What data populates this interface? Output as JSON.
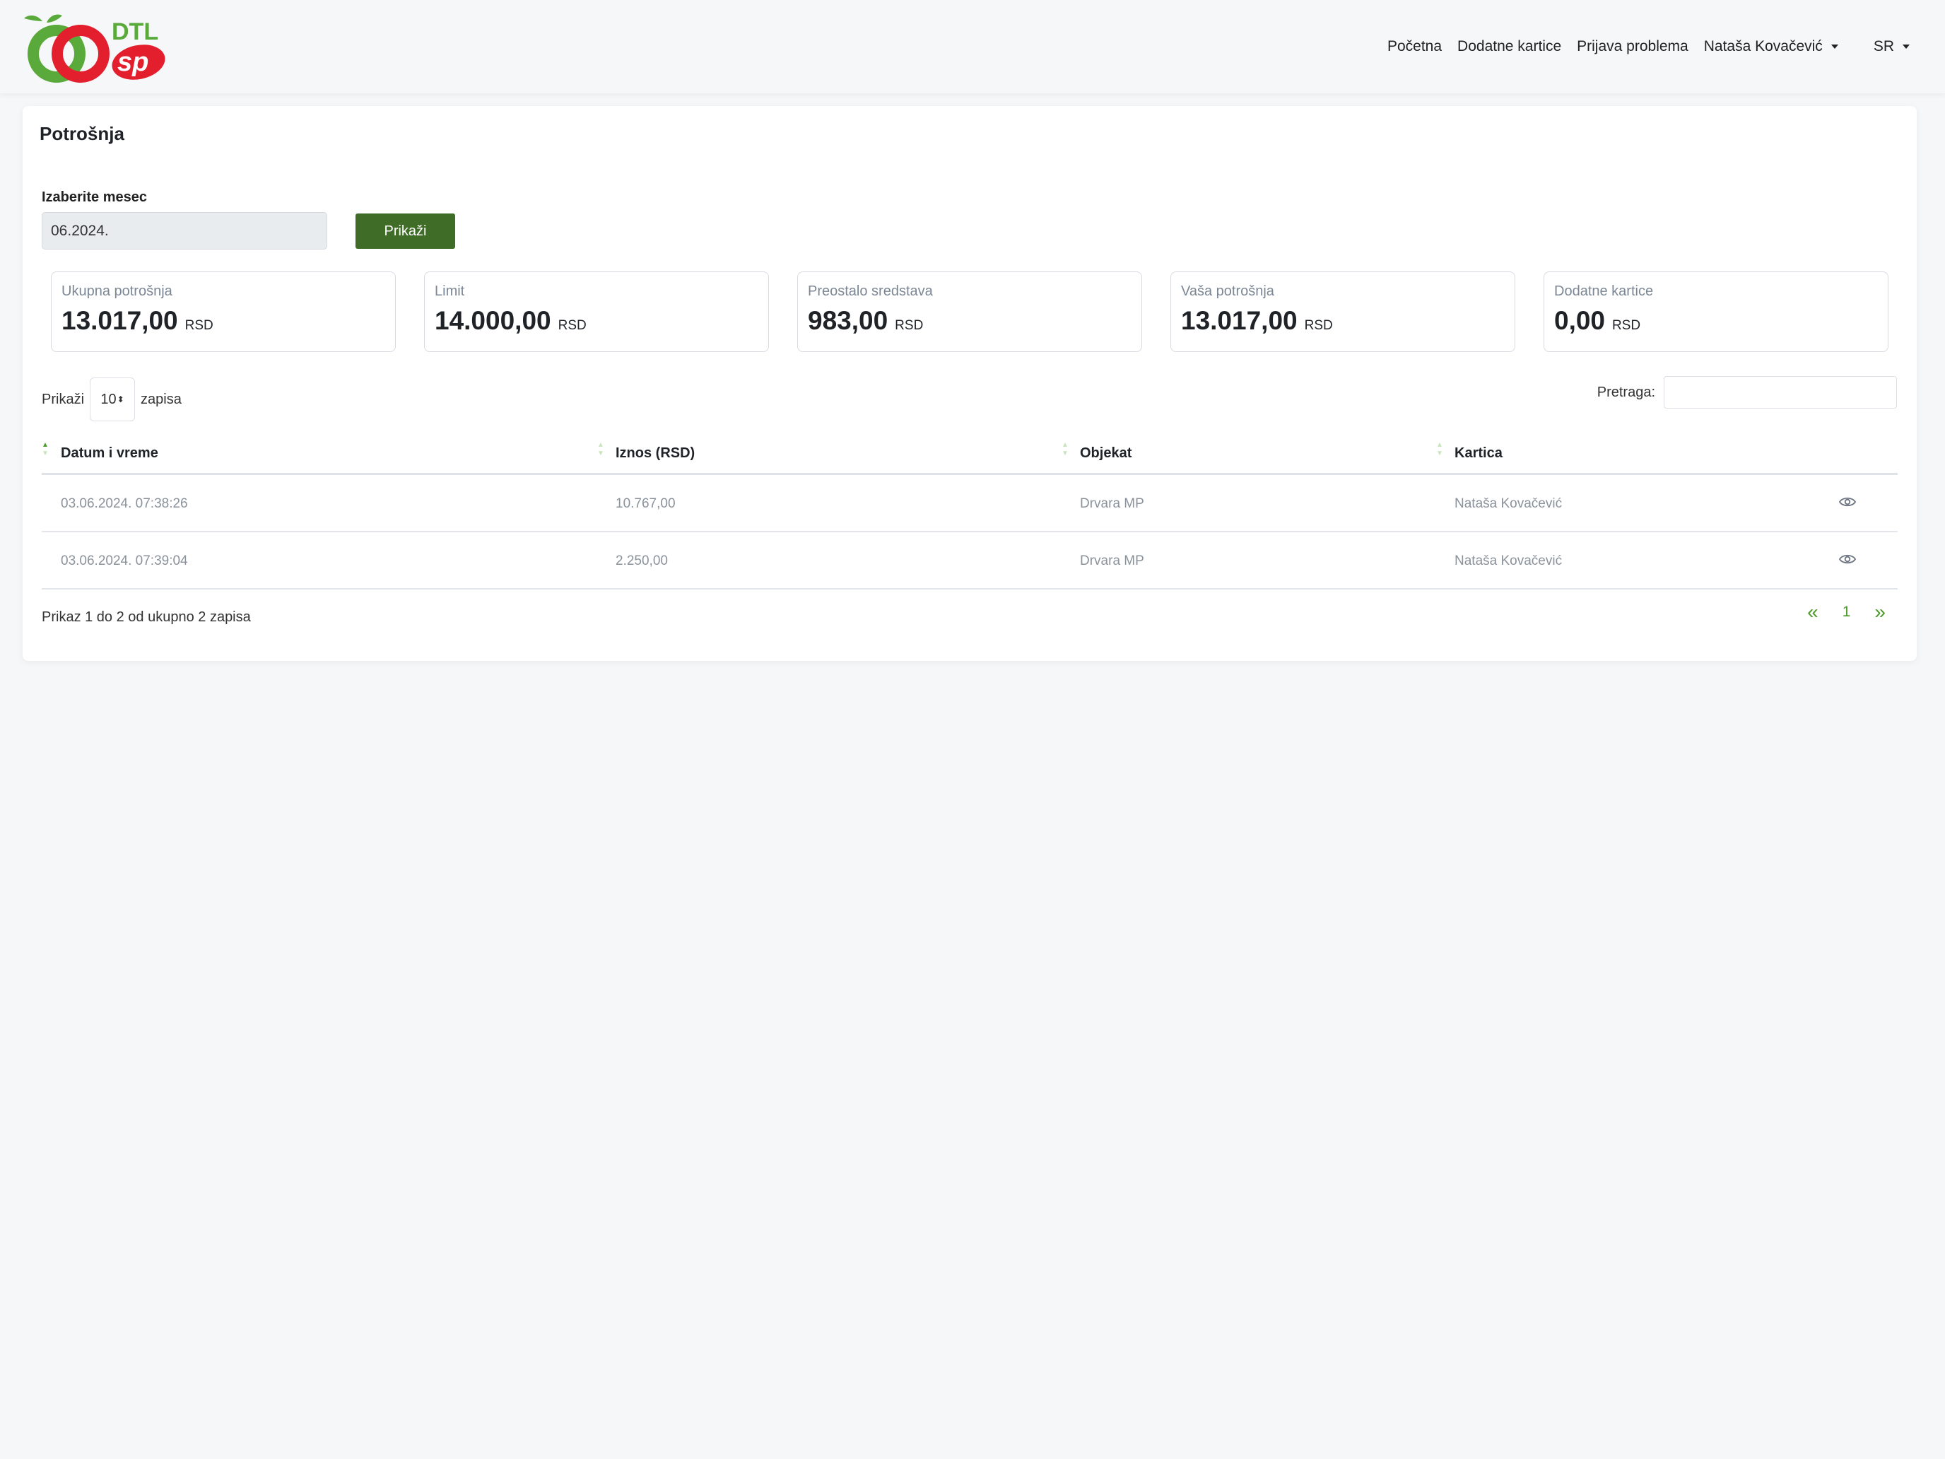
{
  "brand": {
    "line1": "DTL",
    "line2": "sp"
  },
  "nav": {
    "home": "Početna",
    "extra_cards": "Dodatne kartice",
    "report_problem": "Prijava problema",
    "user": "Nataša Kovačević",
    "language": "SR"
  },
  "page": {
    "title": "Potrošnja"
  },
  "filter": {
    "month_label": "Izaberite mesec",
    "month_value": "06.2024.",
    "show_button": "Prikaži"
  },
  "stats": [
    {
      "label": "Ukupna potrošnja",
      "value": "13.017,00",
      "unit": "RSD"
    },
    {
      "label": "Limit",
      "value": "14.000,00",
      "unit": "RSD"
    },
    {
      "label": "Preostalo sredstava",
      "value": "983,00",
      "unit": "RSD"
    },
    {
      "label": "Vaša potrošnja",
      "value": "13.017,00",
      "unit": "RSD"
    },
    {
      "label": "Dodatne kartice",
      "value": "0,00",
      "unit": "RSD"
    }
  ],
  "table_controls": {
    "length_prefix": "Prikaži",
    "length_value": "10",
    "length_suffix": "zapisa",
    "search_label": "Pretraga:",
    "search_value": ""
  },
  "table": {
    "columns": [
      "Datum i vreme",
      "Iznos (RSD)",
      "Objekat",
      "Kartica"
    ],
    "rows": [
      [
        "03.06.2024. 07:38:26",
        "10.767,00",
        "Drvara MP",
        "Nataša Kovačević"
      ],
      [
        "03.06.2024. 07:39:04",
        "2.250,00",
        "Drvara MP",
        "Nataša Kovačević"
      ]
    ]
  },
  "pagination": {
    "info": "Prikaz 1 do 2 od ukupno 2 zapisa",
    "prev": "«",
    "current": "1",
    "next": "»"
  },
  "colors": {
    "primary_button": "#3f6d28",
    "accent_green": "#4d9a2a",
    "logo_red": "#e31e2d",
    "logo_green": "#5aaa3b"
  },
  "icons": [
    "logo",
    "caret-down-icon",
    "sort-icon",
    "eye-icon",
    "double-chevron-left-icon",
    "double-chevron-right-icon"
  ]
}
